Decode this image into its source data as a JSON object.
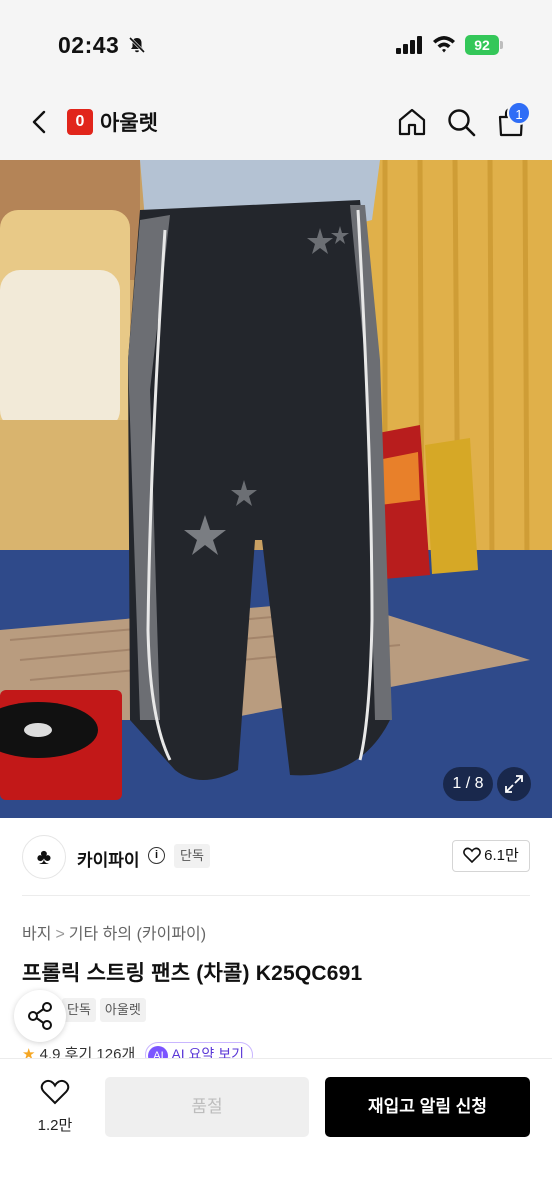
{
  "status_bar": {
    "time": "02:43",
    "battery": "92"
  },
  "nav": {
    "brand_logo_letter": "0",
    "store_name": "아울렛",
    "cart_count": "1"
  },
  "gallery": {
    "page_indicator": "1 / 8"
  },
  "brand": {
    "avatar_glyph": "♣",
    "name": "카이파이",
    "info_glyph": "i",
    "tag": "단독",
    "likes": "6.1만"
  },
  "product": {
    "breadcrumb": [
      "바지",
      "기타 하의 (카이파이)"
    ],
    "breadcrumb_sep": ">",
    "title": "프롤릭 스트링 팬츠 (차콜) K25QC691",
    "tags": [
      "단독",
      "아울렛"
    ],
    "rating_star": "★",
    "rating": "4.9",
    "review_label": "후기 126개",
    "ai_badge": "AI",
    "ai_summary": "AI 요약 보기"
  },
  "bottom_bar": {
    "like_count": "1.2만",
    "soldout_label": "품절",
    "restock_label": "재입고 알림 신청"
  },
  "colors": {
    "accent": "#2f6df6",
    "brand_red": "#e1251b",
    "battery_green": "#34c759"
  },
  "icons": [
    "bell-slash-icon",
    "signal-icon",
    "wifi-icon",
    "chevron-left-icon",
    "home-icon",
    "search-icon",
    "bag-icon",
    "expand-icon",
    "info-icon",
    "heart-icon",
    "share-icon"
  ]
}
